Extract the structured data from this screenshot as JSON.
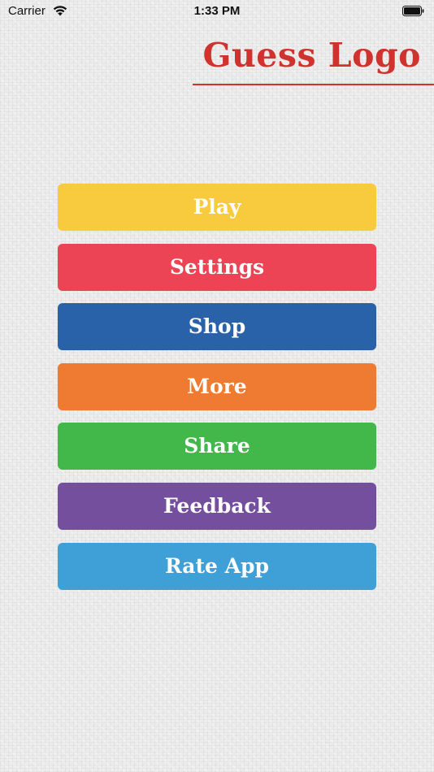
{
  "status_bar": {
    "carrier": "Carrier",
    "time": "1:33 PM",
    "wifi_icon": "wifi-icon",
    "battery_icon": "battery-icon"
  },
  "header": {
    "title": "Guess Logo",
    "title_color": "#d0322d"
  },
  "menu": {
    "buttons": [
      {
        "label": "Play",
        "color": "#f8cb3e"
      },
      {
        "label": "Settings",
        "color": "#ec4455"
      },
      {
        "label": "Shop",
        "color": "#2a62aa"
      },
      {
        "label": "More",
        "color": "#ef7a31"
      },
      {
        "label": "Share",
        "color": "#41b849"
      },
      {
        "label": "Feedback",
        "color": "#744f9e"
      },
      {
        "label": "Rate App",
        "color": "#3f9fd7"
      }
    ]
  }
}
